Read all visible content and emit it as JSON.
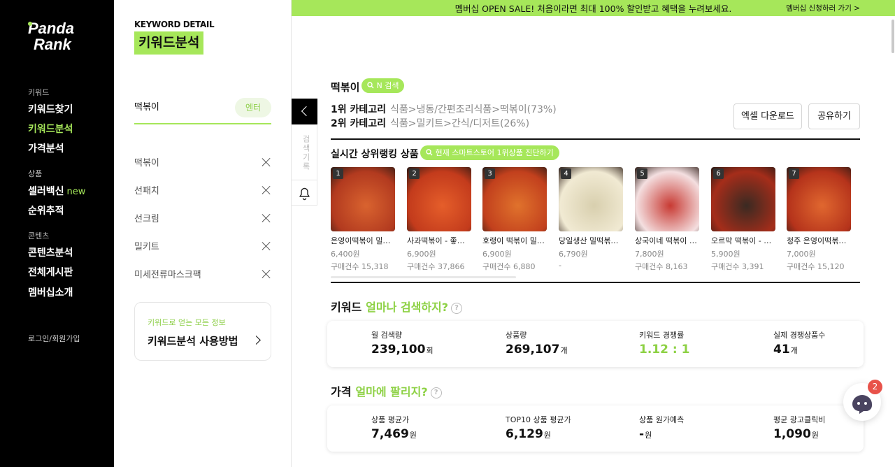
{
  "banner": {
    "text": "멤버십 OPEN SALE! 처음이라면 최대 100% 할인받고 혜택을 누려보세요.",
    "link": "멤버십 신청하러 가기 >"
  },
  "nav": {
    "logo_text": "Panda Rank",
    "sections": [
      {
        "label": "키워드",
        "items": [
          "키워드찾기",
          "키워드분석",
          "가격분석"
        ]
      },
      {
        "label": "상품",
        "items": [
          "셀러백신",
          "순위추적"
        ]
      },
      {
        "label": "콘텐츠",
        "items": [
          "콘텐츠분석",
          "전체게시판",
          "멤버십소개"
        ]
      }
    ],
    "new_badge": "new",
    "active": "키워드분석",
    "login": "로그인/회원가입"
  },
  "panel": {
    "title_en": "KEYWORD DETAIL",
    "title_ko": "키워드분석",
    "search_value": "떡볶이",
    "enter_label": "엔터",
    "history": [
      "떡볶이",
      "선패치",
      "선크림",
      "밀키트",
      "미세전류마스크팩"
    ],
    "howto_sub": "키워드로 얻는 모든 정보",
    "howto_title": "키워드분석 사용방법",
    "history_tab": "검색기록"
  },
  "main": {
    "keyword": "떡볶이",
    "n_search": "N 검색",
    "cat1_label": "1위 카테고리",
    "cat1_value": "식품>냉동/간편조리식품>떡볶이(73%)",
    "cat2_label": "2위 카테고리",
    "cat2_value": "식품>밀키트>간식/디저트(26%)",
    "excel_btn": "엑셀 다운로드",
    "share_btn": "공유하기",
    "rank_title": "실시간 상위랭킹 상품",
    "rank_btn": "현재 스마트스토어 1위상품 진단하기",
    "products": [
      {
        "rank": "1",
        "name": "은영이떡볶이 밀떡…",
        "price": "6,400원",
        "count": "구매건수 15,318",
        "colors": [
          "#b23a1f",
          "#d9632f"
        ]
      },
      {
        "rank": "2",
        "name": "사과떡볶이 - 좋은…",
        "price": "6,900원",
        "count": "구매건수 37,866",
        "colors": [
          "#c33b1c",
          "#e55e2a"
        ]
      },
      {
        "rank": "3",
        "name": "호랭이 떡볶이 밀키…",
        "price": "6,900원",
        "count": "구매건수 6,880",
        "colors": [
          "#c2401d",
          "#e0722c"
        ]
      },
      {
        "rank": "4",
        "name": "당일생산 밀떡볶이…",
        "price": "6,790원",
        "count": "-",
        "colors": [
          "#f1ead3",
          "#d8cfae"
        ]
      },
      {
        "rank": "5",
        "name": "상국이네 떡볶이 -…",
        "price": "7,800원",
        "count": "구매건수 8,163",
        "colors": [
          "#f4dfe0",
          "#c83a33"
        ]
      },
      {
        "rank": "6",
        "name": "오르막 떡볶이 - 오…",
        "price": "5,900원",
        "count": "구매건수 3,391",
        "colors": [
          "#a52d1a",
          "#3a2a22"
        ]
      },
      {
        "rank": "7",
        "name": "청주 은영이떡볶이…",
        "price": "7,000원",
        "count": "구매건수 15,120",
        "colors": [
          "#b5331b",
          "#e0672f"
        ]
      }
    ],
    "keyword_section": {
      "title": "키워드",
      "sub": "얼마나 검색하지?",
      "help": "?",
      "metrics": [
        {
          "label": "월 검색량",
          "value": "239,100",
          "unit": "회"
        },
        {
          "label": "상품량",
          "value": "269,107",
          "unit": "개"
        },
        {
          "label": "키워드 경쟁률",
          "value": "1.12 : 1",
          "unit": ""
        },
        {
          "label": "실제 경쟁상품수",
          "value": "41",
          "unit": "개"
        }
      ]
    },
    "price_section": {
      "title": "가격",
      "sub": "얼마에 팔리지?",
      "help": "?",
      "metrics": [
        {
          "label": "상품 평균가",
          "value": "7,469",
          "unit": "원"
        },
        {
          "label": "TOP10 상품 평균가",
          "value": "6,129",
          "unit": "원"
        },
        {
          "label": "상품 원가예측",
          "value": "-",
          "unit": "원"
        },
        {
          "label": "평균 광고클릭비",
          "value": "1,090",
          "unit": "원"
        }
      ]
    }
  },
  "chat_badge": "2",
  "colors": {
    "accent": "#a6e75a",
    "accent_text": "#8dd144",
    "nav_bg": "#000000"
  }
}
